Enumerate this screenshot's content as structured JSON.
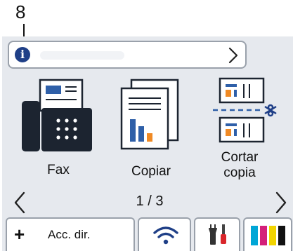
{
  "callout": {
    "number": "8"
  },
  "info_bar": {
    "icon": "info-icon",
    "icon_glyph": "i",
    "chevron": "chevron-right-icon"
  },
  "tiles": [
    {
      "label": "Fax",
      "icon": "fax-icon"
    },
    {
      "label": "Copiar",
      "icon": "copy-icon"
    },
    {
      "label": "Cortar copia",
      "label_line1": "Cortar",
      "label_line2": "copia",
      "icon": "cut-copy-icon"
    }
  ],
  "pagination": {
    "text": "1 / 3",
    "prev_icon": "chevron-left-icon",
    "next_icon": "chevron-right-icon"
  },
  "bottom_bar": {
    "shortcut_label": "Acc. dir.",
    "shortcut_icon": "plus-icon",
    "wifi_icon": "wifi-icon",
    "tools_icon": "tools-icon",
    "toner_icon": "toner-icon"
  },
  "colors": {
    "accent_blue": "#1f3f87",
    "icon_blue": "#2e5fa8",
    "icon_orange": "#f08a24",
    "fax_dark": "#1c2430",
    "screen_bg": "#e6e9ee",
    "toner": [
      "#00a6d6",
      "#d4207a",
      "#f2d400",
      "#111111"
    ]
  }
}
